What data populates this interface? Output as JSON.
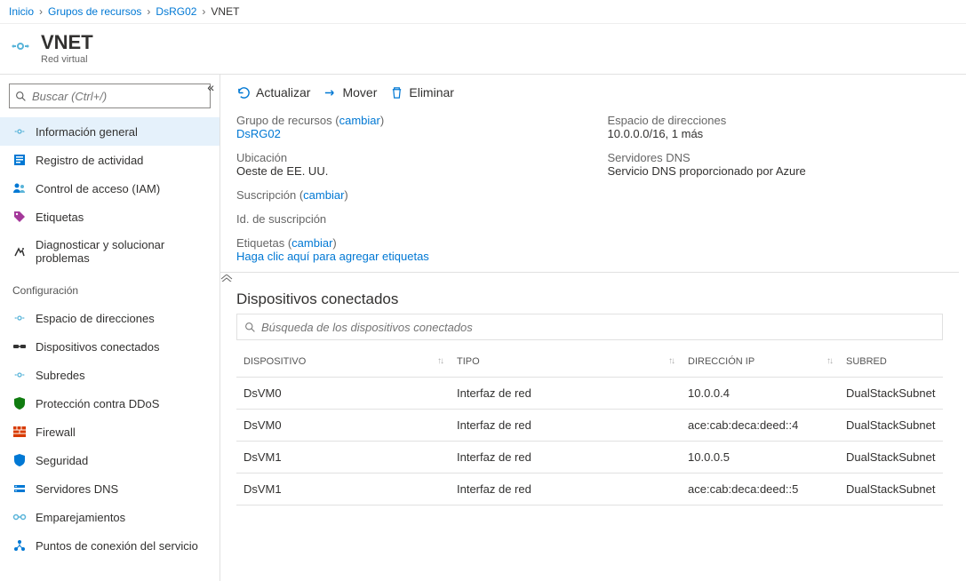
{
  "breadcrumbs": [
    {
      "label": "Inicio",
      "current": false
    },
    {
      "label": "Grupos de recursos",
      "current": false
    },
    {
      "label": "DsRG02",
      "current": false
    },
    {
      "label": "VNET",
      "current": true
    }
  ],
  "title": "VNET",
  "subtitle": "Red virtual",
  "search_placeholder": "Buscar (Ctrl+/)",
  "nav_top": [
    {
      "id": "overview",
      "label": "Información general",
      "icon": "vnet",
      "active": true
    },
    {
      "id": "activity",
      "label": "Registro de actividad",
      "icon": "log",
      "active": false
    },
    {
      "id": "iam",
      "label": "Control de acceso (IAM)",
      "icon": "iam",
      "active": false
    },
    {
      "id": "tags",
      "label": "Etiquetas",
      "icon": "tag",
      "active": false
    },
    {
      "id": "diag",
      "label": "Diagnosticar y solucionar problemas",
      "icon": "diag",
      "active": false
    }
  ],
  "nav_heading": "Configuración",
  "nav_config": [
    {
      "id": "addrspace",
      "label": "Espacio de direcciones",
      "icon": "addr"
    },
    {
      "id": "connected",
      "label": "Dispositivos conectados",
      "icon": "plug"
    },
    {
      "id": "subnets",
      "label": "Subredes",
      "icon": "subnet"
    },
    {
      "id": "ddos",
      "label": "Protección contra DDoS",
      "icon": "shield"
    },
    {
      "id": "firewall",
      "label": "Firewall",
      "icon": "firewall"
    },
    {
      "id": "security",
      "label": "Seguridad",
      "icon": "security"
    },
    {
      "id": "dns",
      "label": "Servidores DNS",
      "icon": "dns"
    },
    {
      "id": "peerings",
      "label": "Emparejamientos",
      "icon": "peer"
    },
    {
      "id": "endpoints",
      "label": "Puntos de conexión del servicio",
      "icon": "endpoint"
    }
  ],
  "toolbar": {
    "refresh": "Actualizar",
    "move": "Mover",
    "delete": "Eliminar"
  },
  "props_left": [
    {
      "label": "Grupo de recursos",
      "change": "cambiar",
      "value_link": "DsRG02"
    },
    {
      "label": "Ubicación",
      "value": "Oeste de EE. UU."
    },
    {
      "label": "Suscripción",
      "change": "cambiar"
    },
    {
      "label": "Id. de suscripción"
    },
    {
      "label": "Etiquetas",
      "change": "cambiar",
      "value_link": "Haga clic aquí para agregar etiquetas"
    }
  ],
  "props_right": [
    {
      "label": "Espacio de direcciones",
      "value": "10.0.0.0/16, 1 más"
    },
    {
      "label": "Servidores DNS",
      "value": "Servicio DNS proporcionado por Azure"
    }
  ],
  "devices": {
    "title": "Dispositivos conectados",
    "search_placeholder": "Búsqueda de los dispositivos conectados",
    "columns": [
      "DISPOSITIVO",
      "TIPO",
      "DIRECCIÓN IP",
      "SUBRED"
    ],
    "rows": [
      {
        "device": "DsVM0",
        "type": "Interfaz de red",
        "ip": "10.0.0.4",
        "subnet": "DualStackSubnet"
      },
      {
        "device": "DsVM0",
        "type": "Interfaz de red",
        "ip": "ace:cab:deca:deed::4",
        "subnet": "DualStackSubnet"
      },
      {
        "device": "DsVM1",
        "type": "Interfaz de red",
        "ip": "10.0.0.5",
        "subnet": "DualStackSubnet"
      },
      {
        "device": "DsVM1",
        "type": "Interfaz de red",
        "ip": "ace:cab:deca:deed::5",
        "subnet": "DualStackSubnet"
      }
    ]
  }
}
